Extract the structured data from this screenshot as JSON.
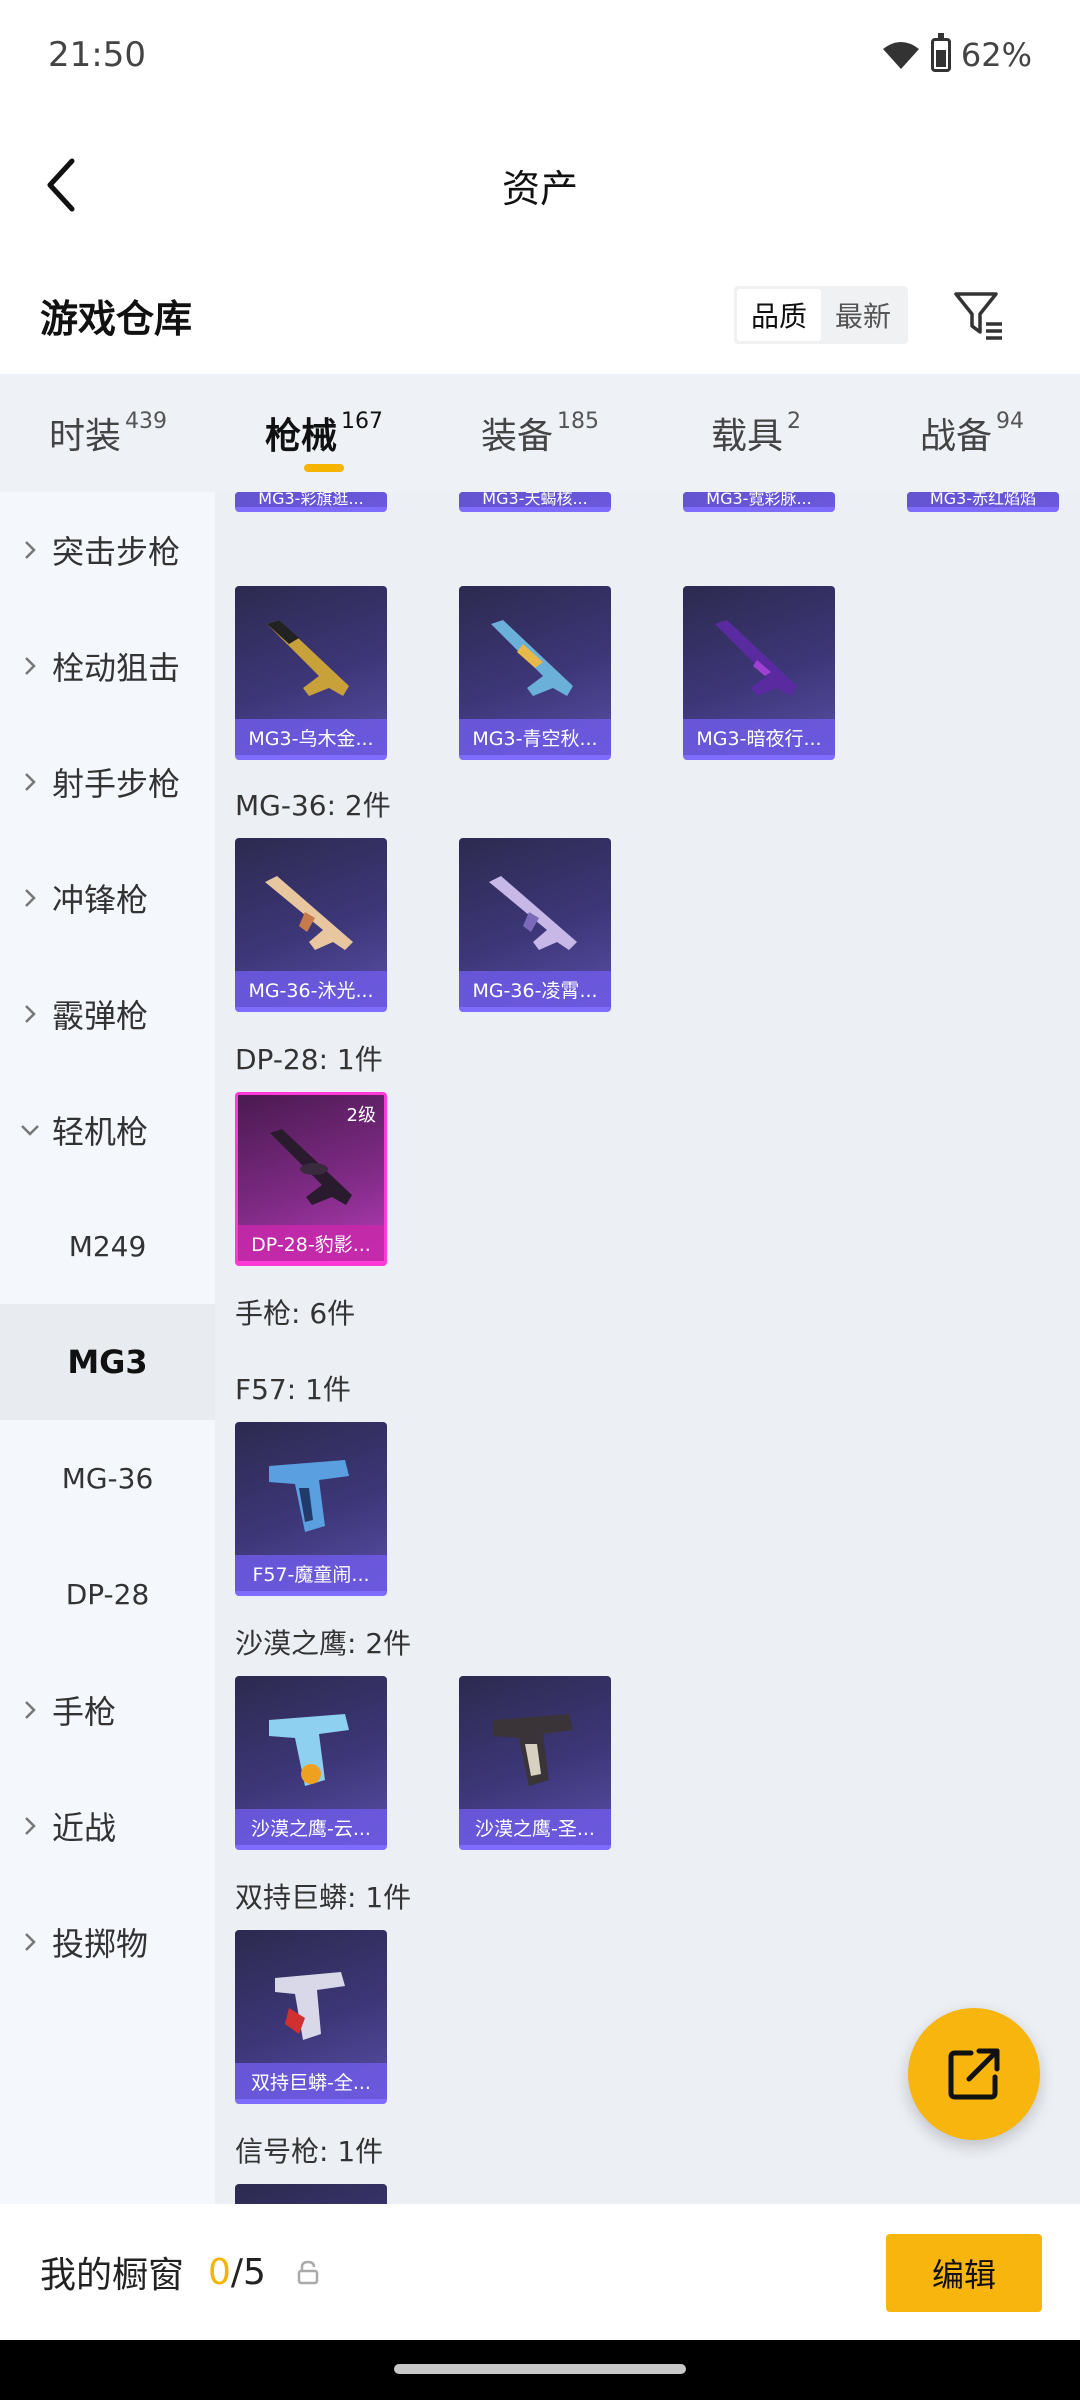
{
  "status": {
    "time": "21:50",
    "battery": "62%"
  },
  "header": {
    "title": "资产"
  },
  "section": {
    "title": "游戏仓库",
    "sort_options": [
      "品质",
      "最新"
    ],
    "active_sort": "品质"
  },
  "tabs": [
    {
      "label": "时装",
      "count": "439"
    },
    {
      "label": "枪械",
      "count": "167",
      "active": true
    },
    {
      "label": "装备",
      "count": "185"
    },
    {
      "label": "载具",
      "count": "2"
    },
    {
      "label": "战备",
      "count": "94"
    }
  ],
  "sidebar": {
    "categories": [
      "突击步枪",
      "栓动狙击",
      "射手步枪",
      "冲锋枪",
      "霰弹枪",
      "轻机枪",
      "手枪",
      "近战",
      "投掷物"
    ],
    "expanded": "轻机枪",
    "subitems": [
      "M249",
      "MG3",
      "MG-36",
      "DP-28"
    ],
    "active_sub": "MG3"
  },
  "content": {
    "partial_row": [
      "MG3-彩旗逛...",
      "MG3-天蝎核...",
      "MG3-霓彩脉...",
      "MG3-赤红焰焰"
    ],
    "mg3_items": [
      "MG3-乌木金...",
      "MG3-青空秋...",
      "MG3-暗夜行..."
    ],
    "mg36_label": "MG-36: 2件",
    "mg36_items": [
      "MG-36-沐光...",
      "MG-36-凌霄..."
    ],
    "dp28_label": "DP-28: 1件",
    "dp28_items": [
      {
        "name": "DP-28-豹影...",
        "level": "2级"
      }
    ],
    "pistol_label": "手枪: 6件",
    "f57_label": "F57: 1件",
    "f57_items": [
      "F57-魔童闹..."
    ],
    "deagle_label": "沙漠之鹰: 2件",
    "deagle_items": [
      "沙漠之鹰-云...",
      "沙漠之鹰-圣..."
    ],
    "python_label": "双持巨蟒: 1件",
    "python_items": [
      "双持巨蟒-全..."
    ],
    "flare_label": "信号枪: 1件"
  },
  "bottom": {
    "window_label": "我的橱窗",
    "window_current": "0",
    "window_total": "/5",
    "edit_label": "编辑"
  },
  "colors": {
    "accent": "#f7b50d",
    "card": "#3d3779",
    "card_purple": "#b63cb8"
  }
}
